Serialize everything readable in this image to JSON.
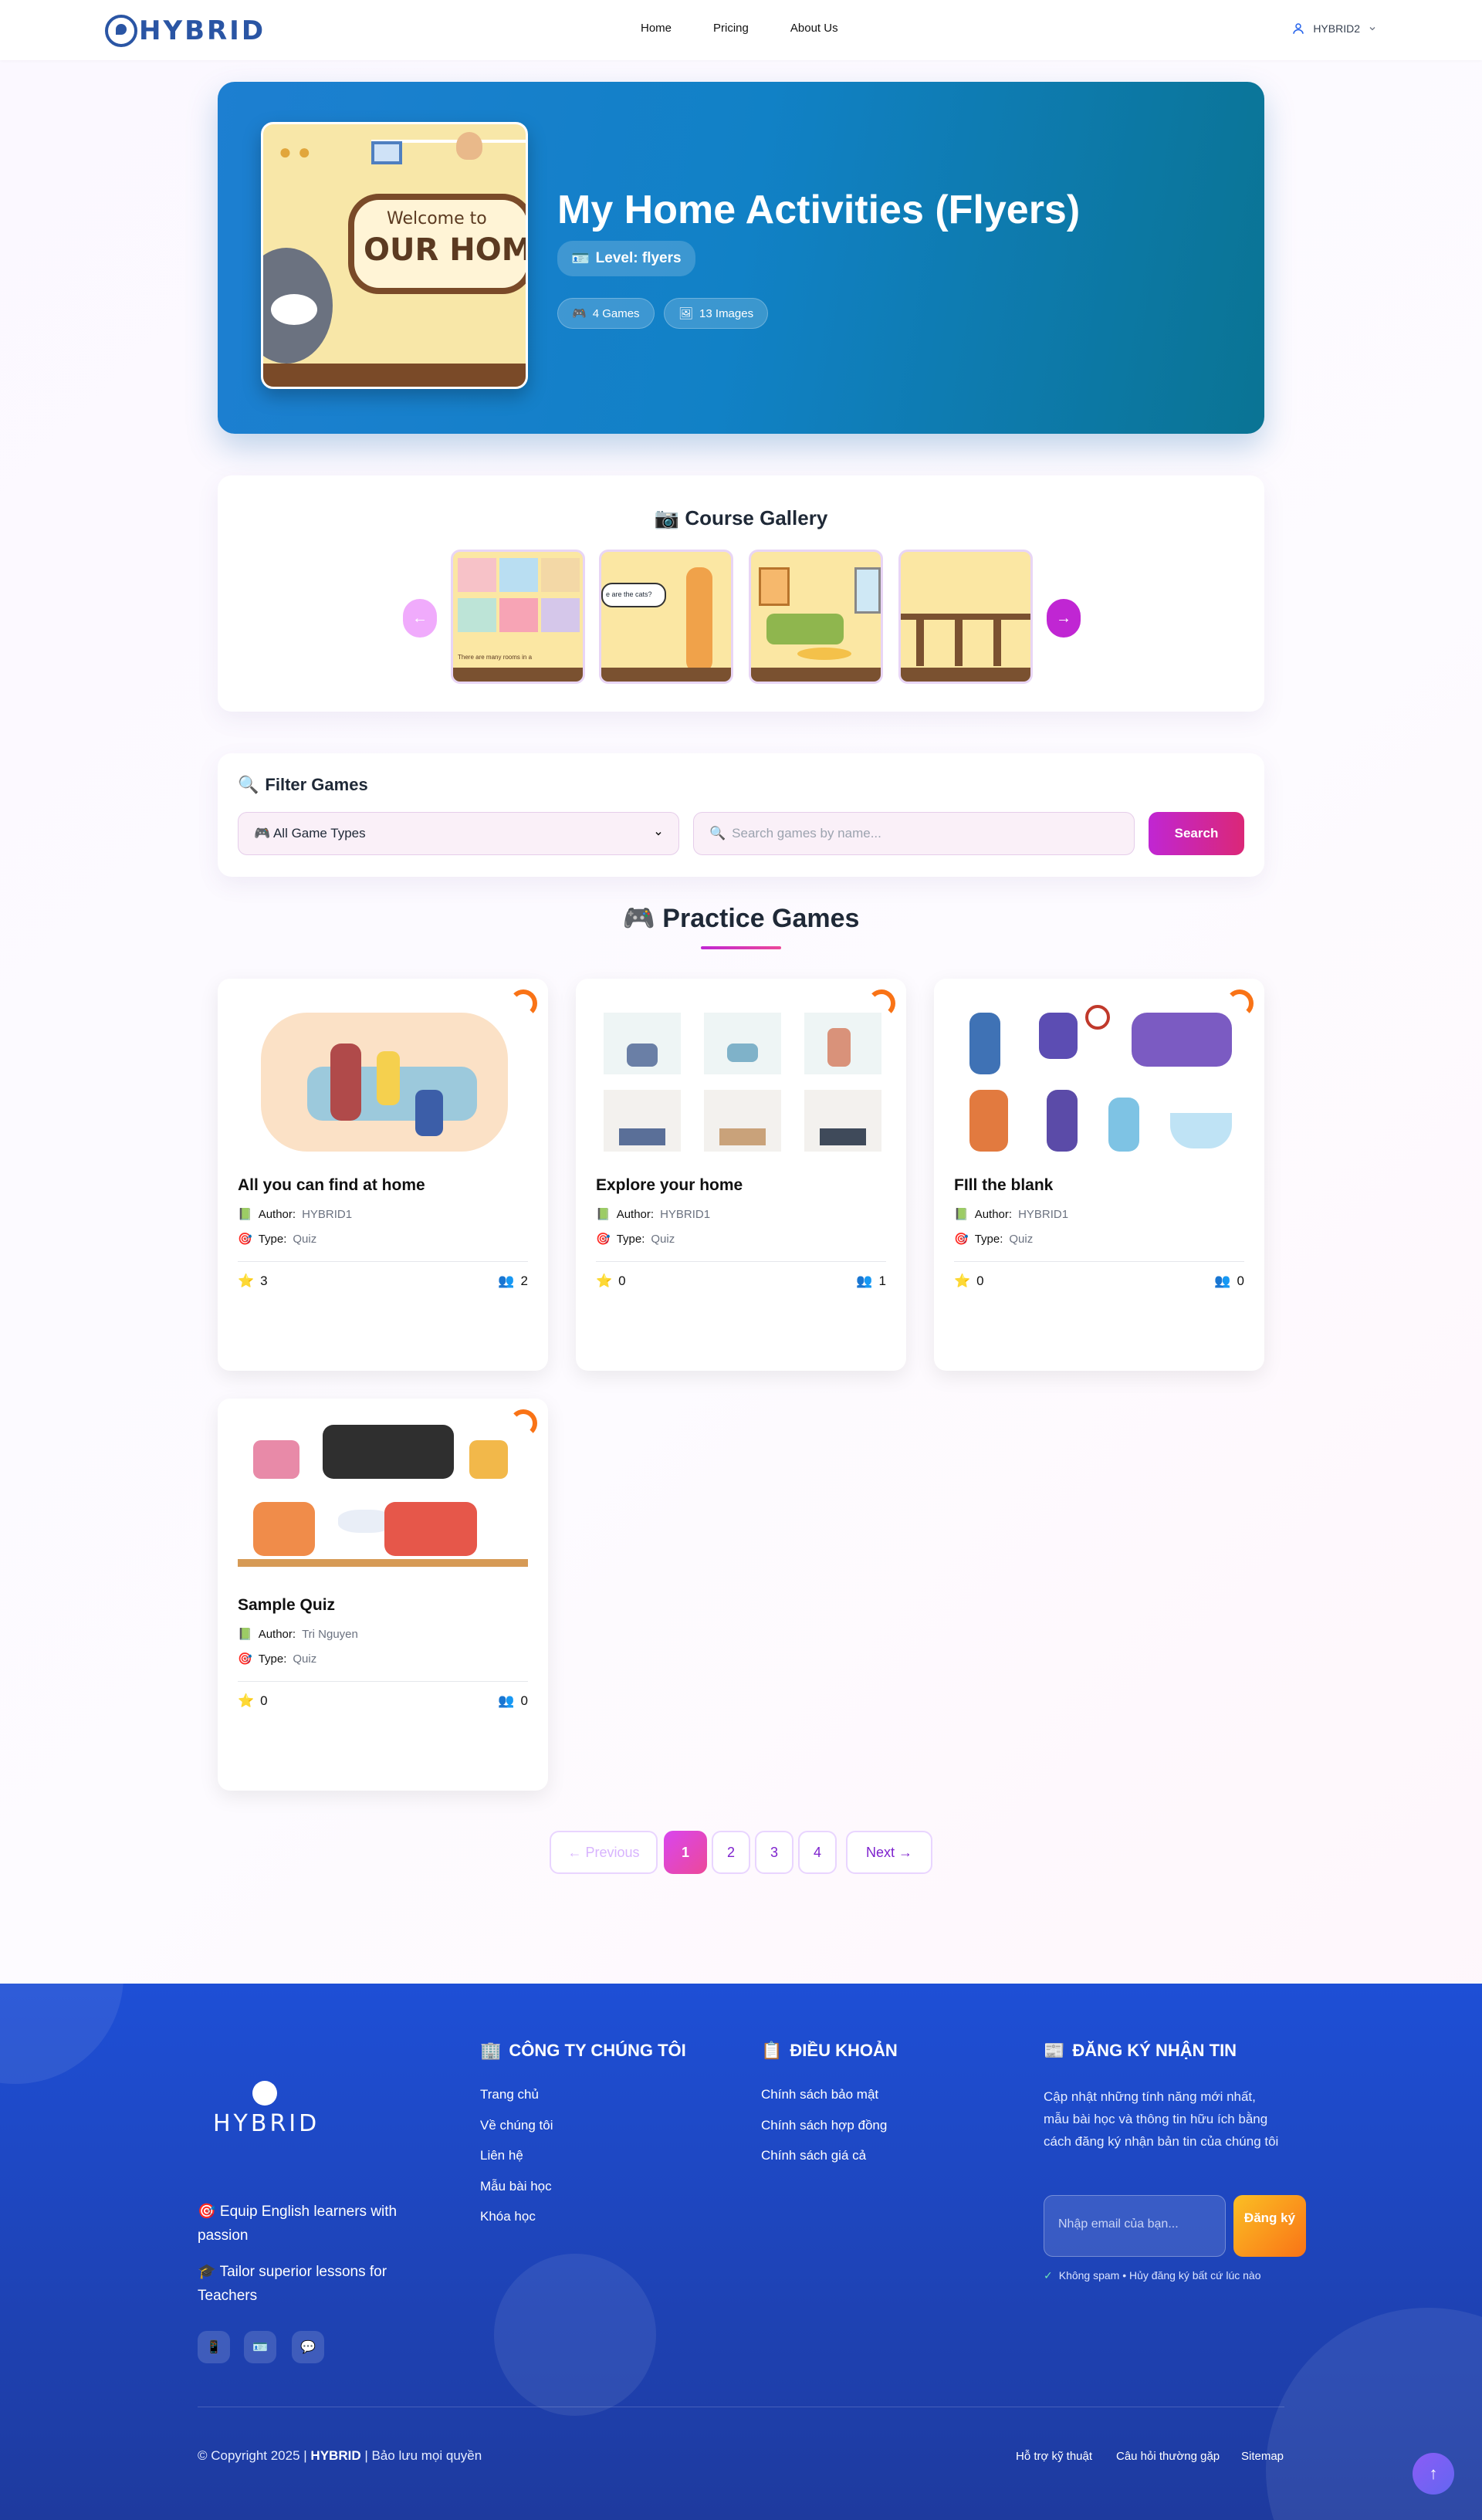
{
  "nav": {
    "brand": "HYBRID",
    "links": [
      "Home",
      "Pricing",
      "About Us"
    ],
    "user": "HYBRID2"
  },
  "hero": {
    "title": "My Home Activities (Flyers)",
    "level": "Level: flyers",
    "games": "4 Games",
    "images": "13 Images",
    "image_text_1": "Welcome to",
    "image_text_2": "OUR HOME"
  },
  "gallery": {
    "title": "Course Gallery",
    "prev": "←",
    "next": "→",
    "thumb_caption": "There are many rooms in a",
    "speech": "e are the cats?"
  },
  "filter": {
    "title": "Filter Games",
    "select": "All Game Types",
    "search_placeholder": "Search games by name...",
    "search_button": "Search"
  },
  "games_section": {
    "title": "Practice Games"
  },
  "labels": {
    "author": "Author:",
    "type": "Type:"
  },
  "games": [
    {
      "title": "All you can find at home",
      "author": "HYBRID1",
      "type": "Quiz",
      "stars": "3",
      "players": "2"
    },
    {
      "title": "Explore your home",
      "author": "HYBRID1",
      "type": "Quiz",
      "stars": "0",
      "players": "1"
    },
    {
      "title": "FIll the blank",
      "author": "HYBRID1",
      "type": "Quiz",
      "stars": "0",
      "players": "0"
    },
    {
      "title": "Sample Quiz",
      "author": "Tri Nguyen",
      "type": "Quiz",
      "stars": "0",
      "players": "0"
    }
  ],
  "pagination": {
    "prev": "← Previous",
    "pages": [
      "1",
      "2",
      "3",
      "4"
    ],
    "next": "Next →",
    "current": "1"
  },
  "footer": {
    "brand": "HYBRID",
    "tagline_1": "🎯 Equip English learners with passion",
    "tagline_2": "🎓 Tailor superior lessons for Teachers",
    "company_title": "CÔNG TY CHÚNG TÔI",
    "company_links": [
      "Trang chủ",
      "Về chúng tôi",
      "Liên hệ",
      "Mẫu bài học",
      "Khóa học"
    ],
    "terms_title": "ĐIỀU KHOẢN",
    "terms_links": [
      "Chính sách bảo mật",
      "Chính sách hợp đồng",
      "Chính sách giá cả"
    ],
    "newsletter_title": "ĐĂNG KÝ NHẬN TIN",
    "newsletter_desc": "Cập nhật những tính năng mới nhất, mẫu bài học và thông tin hữu ích bằng cách đăng ký nhận bản tin của chúng tôi",
    "email_placeholder": "Nhập email của bạn...",
    "subscribe": "Đăng ký",
    "nospam": "Không spam • Hủy đăng ký bất cứ lúc nào",
    "copyright_pre": "© Copyright 2025 |",
    "copyright_brand": "HYBRID",
    "copyright_post": "| Bảo lưu mọi quyền",
    "bottom_links": [
      "Hỗ trợ kỹ thuật",
      "Câu hỏi thường gặp",
      "Sitemap"
    ],
    "top_button": "↑"
  },
  "colors": {
    "accent": "#c026d3",
    "hero": "#1181c6",
    "footer": "#1e4fd6"
  }
}
